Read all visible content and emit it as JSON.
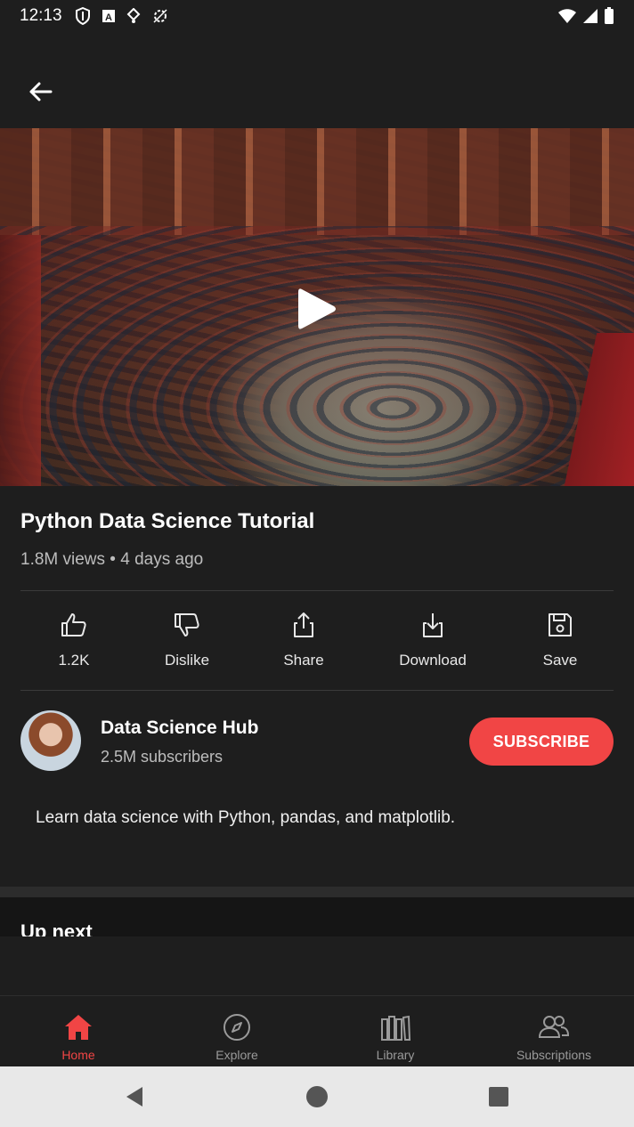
{
  "status_bar": {
    "time": "12:13"
  },
  "video": {
    "title": "Python Data Science Tutorial",
    "meta": "1.8M views • 4 days ago"
  },
  "actions": [
    {
      "label": "1.2K",
      "icon": "thumbs-up-icon"
    },
    {
      "label": "Dislike",
      "icon": "thumbs-down-icon"
    },
    {
      "label": "Share",
      "icon": "share-icon"
    },
    {
      "label": "Download",
      "icon": "download-icon"
    },
    {
      "label": "Save",
      "icon": "save-icon"
    }
  ],
  "channel": {
    "name": "Data Science Hub",
    "subscribers": "2.5M subscribers",
    "subscribe_label": "SUBSCRIBE"
  },
  "description": "Learn data science with Python, pandas, and matplotlib.",
  "up_next": {
    "heading": "Up next"
  },
  "bottom_nav": [
    {
      "label": "Home",
      "icon": "home-icon",
      "active": true
    },
    {
      "label": "Explore",
      "icon": "compass-icon",
      "active": false
    },
    {
      "label": "Library",
      "icon": "library-icon",
      "active": false
    },
    {
      "label": "Subscriptions",
      "icon": "subscriptions-icon",
      "active": false
    }
  ],
  "colors": {
    "accent": "#f14545",
    "background": "#1e1e1e"
  }
}
